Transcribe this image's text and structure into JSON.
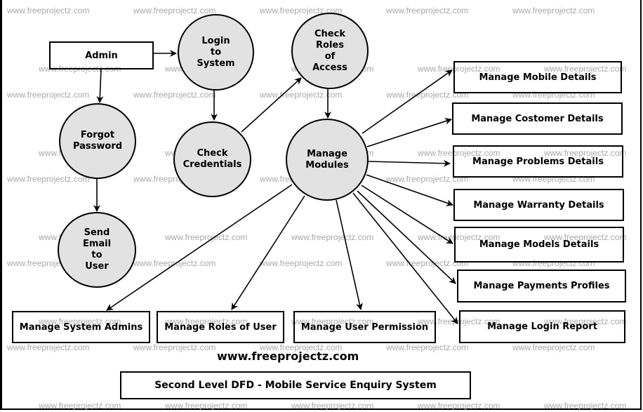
{
  "watermark_text": "www.freeprojectz.com",
  "entities": {
    "admin": "Admin",
    "mobile": "Manage Mobile Details",
    "costomer": "Manage Costomer Details",
    "problems": "Manage Problems Details",
    "warranty": "Manage Warranty Details",
    "models": "Manage Models Details",
    "payments": "Manage Payments Profiles",
    "login_report": "Manage Login Report",
    "system_admins": "Manage System Admins",
    "roles_of_user": "Manage Roles of User",
    "user_permission": "Manage User Permission"
  },
  "processes": {
    "login": "Login\nto\nSystem",
    "check_roles": "Check\nRoles\nof\nAccess",
    "forgot_password": "Forgot\nPassword",
    "check_credentials": "Check\nCredentials",
    "manage_modules": "Manage\nModules",
    "send_email": "Send\nEmail\nto\nUser"
  },
  "footer": {
    "website": "www.freeprojectz.com",
    "title": "Second Level DFD - Mobile Service Enquiry System"
  },
  "colors": {
    "process_fill": "#e2e2e2",
    "stroke": "#000000",
    "watermark": "#a8a8a8"
  }
}
